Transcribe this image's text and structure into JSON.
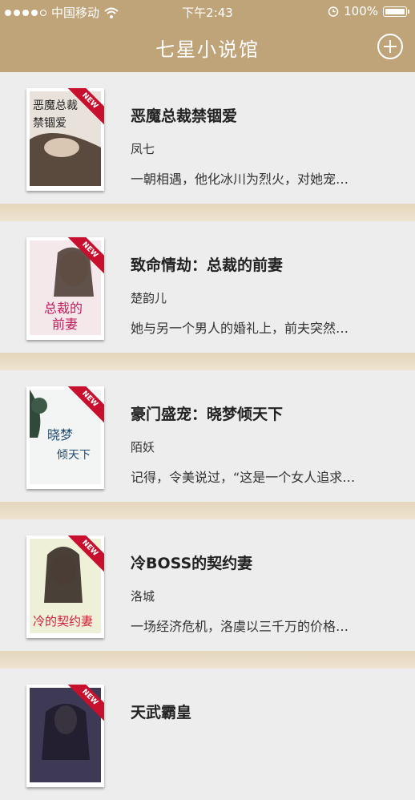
{
  "status_bar": {
    "carrier": "中国移动",
    "time": "下午2:43",
    "battery": "100%",
    "battery_level": 1.0,
    "signal_bars": 4
  },
  "nav": {
    "title": "七星小说馆",
    "add_icon": "plus-circle-icon"
  },
  "colors": {
    "accent": "#bfa47a",
    "ribbon": "#c8102e",
    "card_bg": "#ededed"
  },
  "books": [
    {
      "title": "恶魔总裁禁锢爱",
      "author": "凤七",
      "desc": "一朝相遇，他化冰川为烈火，对她宠…",
      "badge": "NEW"
    },
    {
      "title": "致命情劫：总裁的前妻",
      "author": "楚韵儿",
      "desc": "她与另一个男人的婚礼上，前夫突然…",
      "badge": "NEW"
    },
    {
      "title": "豪门盛宠：晓梦倾天下",
      "author": "陌妖",
      "desc": "记得，令美说过，“这是一个女人追求…",
      "badge": "NEW"
    },
    {
      "title": "冷BOSS的契约妻",
      "author": "洛城",
      "desc": "一场经济危机，洛虞以三千万的价格…",
      "badge": "NEW"
    },
    {
      "title": "天武霸皇",
      "author": "",
      "desc": "",
      "badge": "NEW"
    }
  ]
}
